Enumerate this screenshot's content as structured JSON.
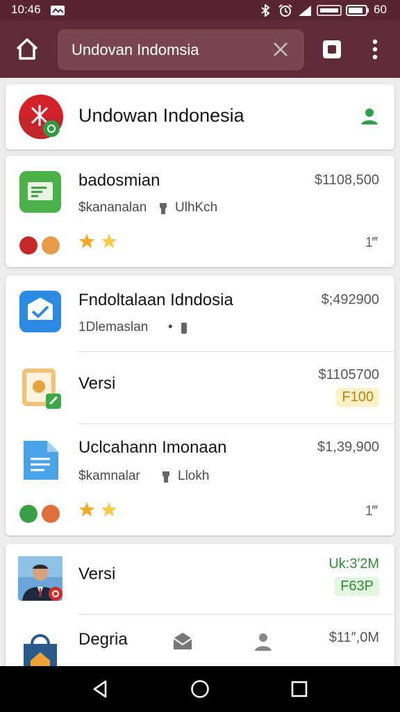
{
  "status_bar": {
    "time": "10:46",
    "battery_text": "60"
  },
  "toolbar": {
    "url_text": "Undovan Indomsia"
  },
  "header_card": {
    "title": "Undowan Indonesia"
  },
  "items": [
    {
      "title": "badosmian",
      "subtitle_a": "$kananalan",
      "subtitle_b": "UlhKch",
      "price": "$1108,500",
      "count": "1‴"
    },
    {
      "title": "Fndoltalaan Idndosia",
      "subtitle_a": "1Dlemaslan",
      "subtitle_b": "•",
      "price": "$;492900"
    },
    {
      "title": "Versi",
      "price": "$1105700",
      "badge": "F100"
    },
    {
      "title": "Uclcahann Imonaan",
      "subtitle_a": "$kamnalar",
      "subtitle_b": "Llokh",
      "price": "$1,39,900",
      "count": "1‴"
    },
    {
      "title": "Versi",
      "price": "Uk:3′2M",
      "badge": "F63P"
    },
    {
      "title": "Degria",
      "price": "$11″,0M"
    }
  ],
  "colors": {
    "toolbar": "#5c2b37",
    "status_bar": "#5a2532",
    "price_green": "#2e8b3a",
    "badge_yellow_bg": "#fdf2c8",
    "badge_green_bg": "#e3f6df"
  },
  "icons": [
    "home-icon",
    "clear-icon",
    "tab-switcher-icon",
    "overflow-menu-icon",
    "person-icon",
    "star-icon",
    "back-icon",
    "home-nav-icon",
    "recents-icon"
  ]
}
